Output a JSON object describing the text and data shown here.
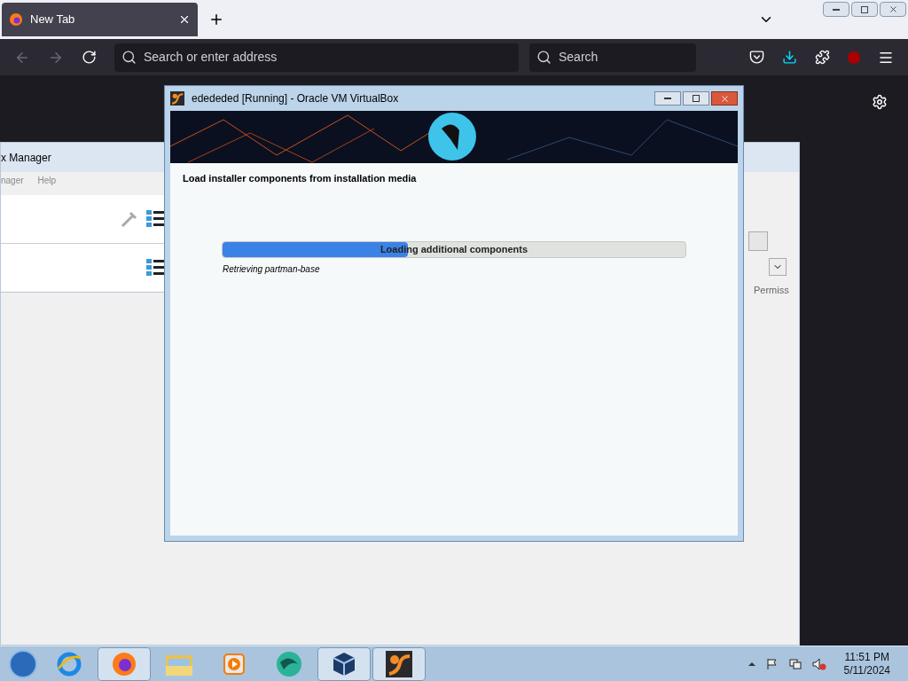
{
  "browser": {
    "tabs": [
      {
        "label": "New Tab",
        "selected": true
      }
    ],
    "address": {
      "placeholder": "Search or enter address"
    },
    "search": {
      "placeholder": "Search"
    }
  },
  "manager": {
    "title": "x Manager",
    "menu": [
      "nager",
      "Help"
    ],
    "column": "Permiss"
  },
  "vm_window": {
    "title": "edededed [Running] - Oracle VM VirtualBox",
    "heading": "Load installer components from installation media",
    "progress": {
      "label": "Loading additional components",
      "level": 0.4
    },
    "status": "Retrieving partman-base"
  },
  "taskbar": {
    "apps": [
      {
        "kind": "ie",
        "selected": false
      },
      {
        "kind": "firefox",
        "selected": true
      },
      {
        "kind": "folder",
        "selected": false
      },
      {
        "kind": "media",
        "selected": false
      },
      {
        "kind": "globe",
        "selected": false
      },
      {
        "kind": "cube",
        "selected": true
      },
      {
        "kind": "vm",
        "selected": true
      }
    ],
    "time": "11:51 PM",
    "date": "5/11/2024"
  }
}
